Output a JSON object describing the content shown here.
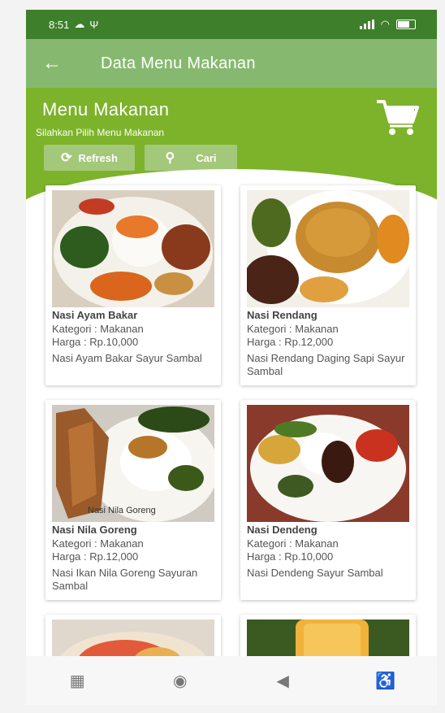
{
  "status_bar": {
    "time": "8:51",
    "icons": [
      "cloud-icon",
      "usb-icon",
      "signal-icon",
      "wifi-icon",
      "battery-icon"
    ]
  },
  "toolbar": {
    "title": "Data Menu Makanan",
    "back_icon": "arrow-left-icon"
  },
  "header": {
    "title": "Menu Makanan",
    "subtitle": "Silahkan Pilih Menu Makanan",
    "cart_icon": "shopping-cart-icon",
    "refresh_label": "Refresh",
    "search_label": "Cari"
  },
  "menu_items": [
    {
      "name": "Nasi Ayam Bakar",
      "kategori": "Kategori : Makanan",
      "harga": "Harga : Rp.10,000",
      "deskripsi": "Nasi Ayam Bakar Sayur Sambal"
    },
    {
      "name": "Nasi Rendang",
      "kategori": "Kategori : Makanan",
      "harga": "Harga : Rp.12,000",
      "deskripsi": "Nasi Rendang Daging Sapi Sayur Sambal"
    },
    {
      "name": "Nasi Nila Goreng",
      "kategori": "Kategori : Makanan",
      "harga": "Harga : Rp.12,000",
      "deskripsi": "Nasi Ikan Nila Goreng Sayuran Sambal",
      "image_caption": "Nasi Nila Goreng"
    },
    {
      "name": "Nasi Dendeng",
      "kategori": "Kategori : Makanan",
      "harga": "Harga : Rp.10,000",
      "deskripsi": "Nasi Dendeng Sayur Sambal"
    }
  ],
  "nav_bar": {
    "icons": [
      "recent-apps-icon",
      "home-icon",
      "back-icon",
      "accessibility-icon"
    ]
  },
  "colors": {
    "status_bar": "#3d7f2a",
    "toolbar": "#86b96f",
    "header": "#7cb32a",
    "button": "#a4c87a"
  }
}
